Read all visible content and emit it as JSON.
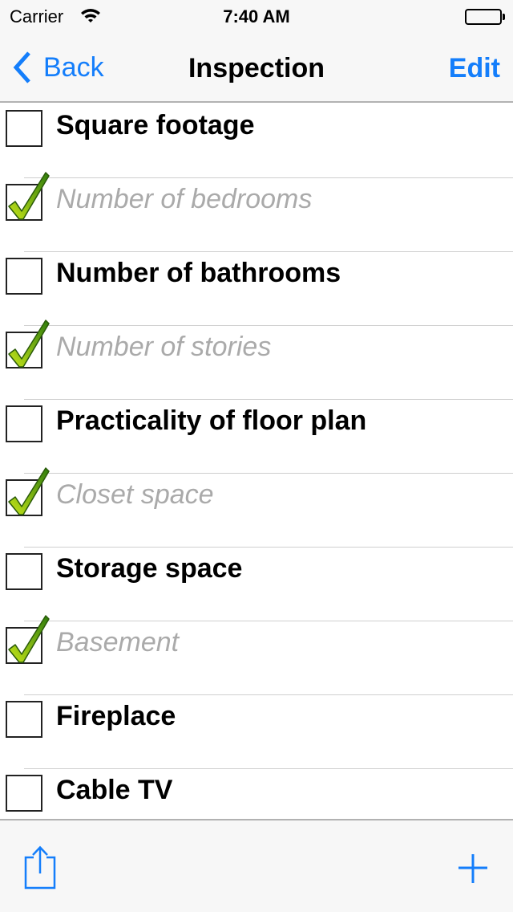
{
  "status_bar": {
    "carrier": "Carrier",
    "time": "7:40 AM",
    "wifi_icon": "wifi-icon",
    "battery_icon": "battery-icon",
    "battery_level": 1.0
  },
  "nav_bar": {
    "back_label": "Back",
    "back_icon": "chevron-left-icon",
    "title": "Inspection",
    "edit_label": "Edit"
  },
  "checklist": {
    "items": [
      {
        "label": "Square footage",
        "checked": false
      },
      {
        "label": "Number of bedrooms",
        "checked": true
      },
      {
        "label": "Number of bathrooms",
        "checked": false
      },
      {
        "label": "Number of stories",
        "checked": true
      },
      {
        "label": "Practicality of floor plan",
        "checked": false
      },
      {
        "label": "Closet space",
        "checked": true
      },
      {
        "label": "Storage space",
        "checked": false
      },
      {
        "label": "Basement",
        "checked": true
      },
      {
        "label": "Fireplace",
        "checked": false
      },
      {
        "label": "Cable TV",
        "checked": false
      }
    ]
  },
  "toolbar": {
    "share_icon": "share-icon",
    "add_icon": "plus-icon"
  },
  "colors": {
    "accent": "#147efb",
    "checked_text": "#aaaaaa",
    "check_green_light": "#c6e61a",
    "check_green_dark": "#2f7d0b",
    "bar_background": "#f7f7f7"
  }
}
